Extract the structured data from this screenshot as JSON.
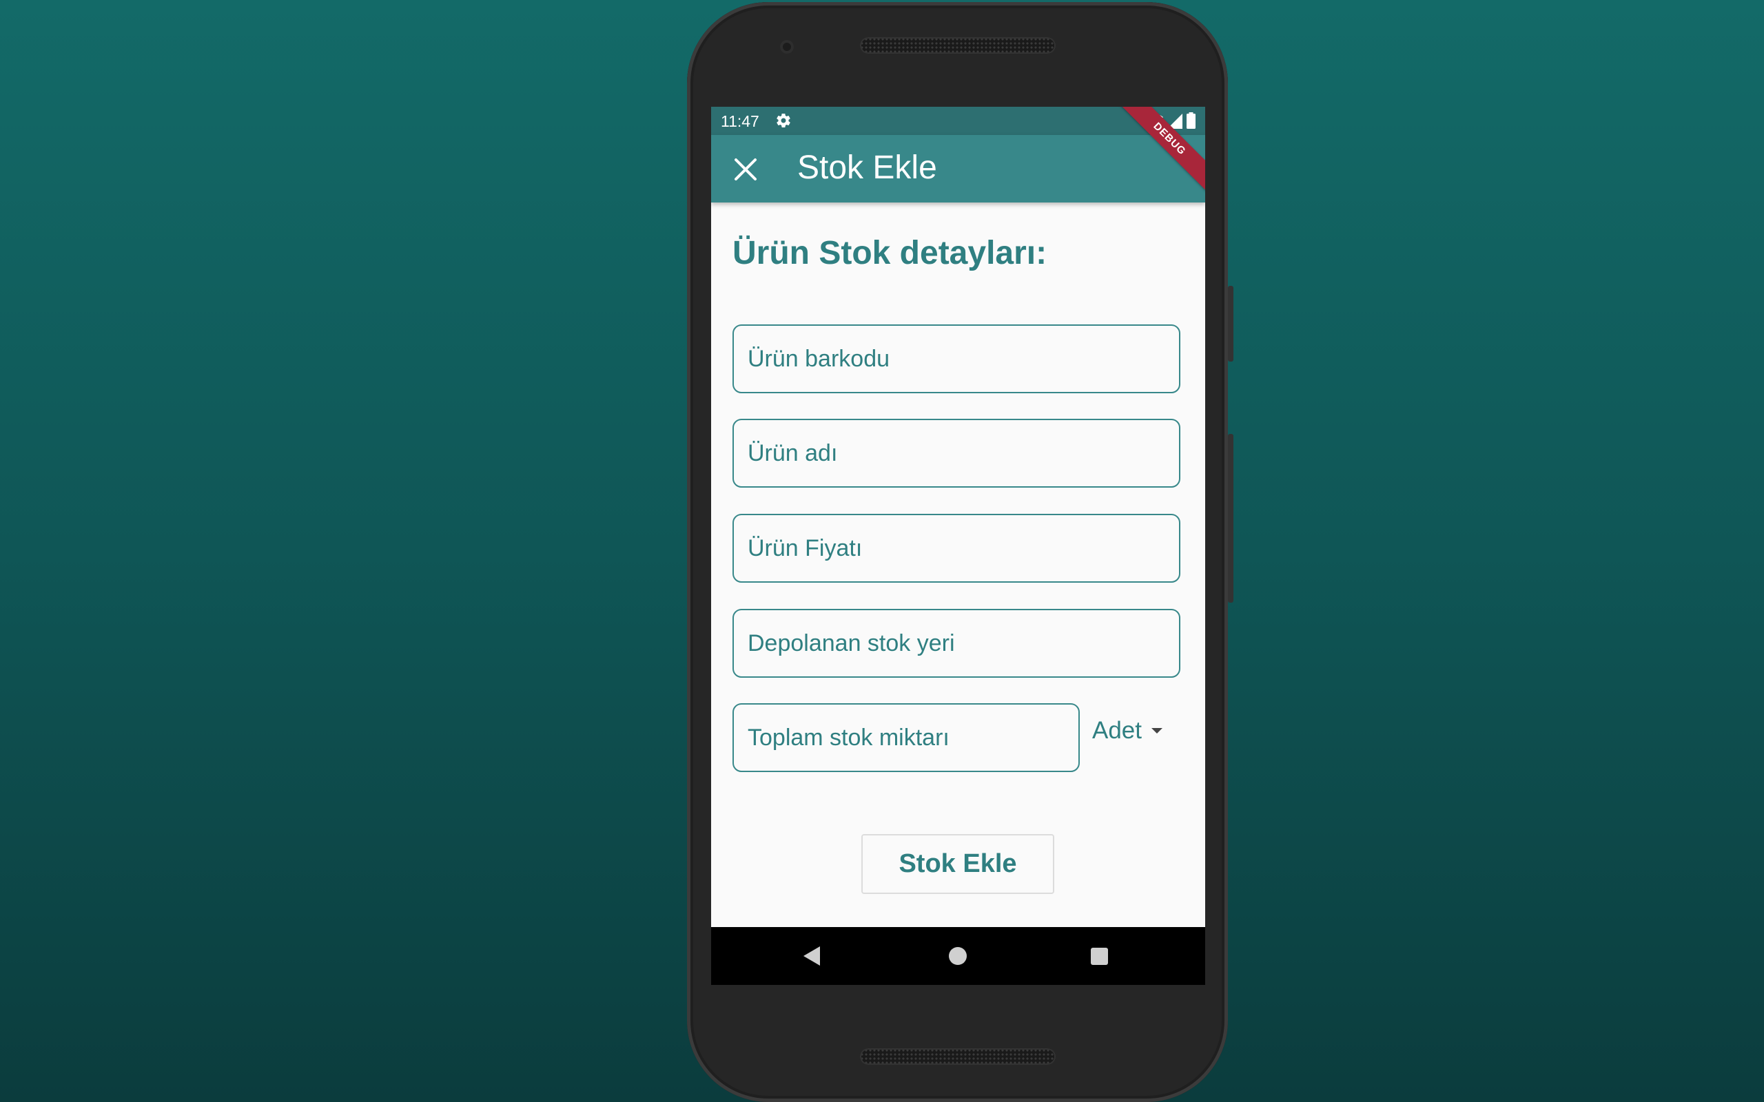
{
  "status_bar": {
    "time": "11:47",
    "icons": [
      "settings-icon",
      "wifi-icon",
      "signal-icon",
      "battery-icon"
    ]
  },
  "app_bar": {
    "title": "Stok Ekle",
    "close_icon": "close-icon",
    "debug_banner": "DEBUG",
    "color": "#38888a"
  },
  "form": {
    "section_title": "Ürün Stok detayları:",
    "fields": {
      "barcode": {
        "placeholder": "Ürün barkodu",
        "value": ""
      },
      "name": {
        "placeholder": "Ürün adı",
        "value": ""
      },
      "price": {
        "placeholder": "Ürün Fiyatı",
        "value": ""
      },
      "location": {
        "placeholder": "Depolanan stok yeri",
        "value": ""
      },
      "quantity": {
        "placeholder": "Toplam stok miktarı",
        "value": ""
      }
    },
    "unit_select": {
      "selected": "Adet"
    },
    "submit_label": "Stok Ekle"
  },
  "nav_bar": {
    "icons": [
      "back-icon",
      "home-icon",
      "recent-apps-icon"
    ]
  },
  "colors": {
    "accent": "#2f7f81",
    "background_top": "#136a68",
    "background_bottom": "#0b3c3d"
  }
}
